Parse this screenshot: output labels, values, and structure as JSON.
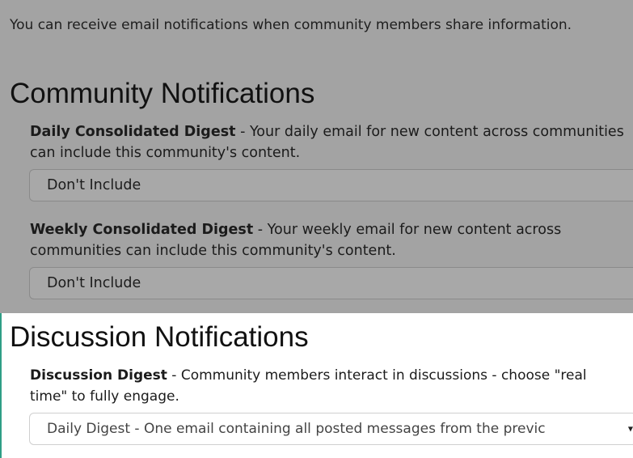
{
  "intro_text": "You can receive email notifications when community members share information.",
  "community": {
    "heading": "Community Notifications",
    "daily": {
      "title": "Daily Consolidated Digest",
      "description": " - Your daily email for new content across communities can include this community's content.",
      "selected": "Don't Include"
    },
    "weekly": {
      "title": "Weekly Consolidated Digest",
      "description": " - Your weekly email for new content across communities can include this community's content.",
      "selected": "Don't Include"
    }
  },
  "discussion": {
    "heading": "Discussion Notifications",
    "digest": {
      "title": "Discussion Digest",
      "description": " - Community members interact in discussions - choose \"real time\" to fully engage.",
      "selected": "Daily Digest - One email containing all posted messages from the previc"
    }
  },
  "icons": {
    "dropdown_arrow": "▼"
  },
  "colors": {
    "overlay_gray": "#a3a3a3",
    "frame_accent": "#2e9e86"
  }
}
